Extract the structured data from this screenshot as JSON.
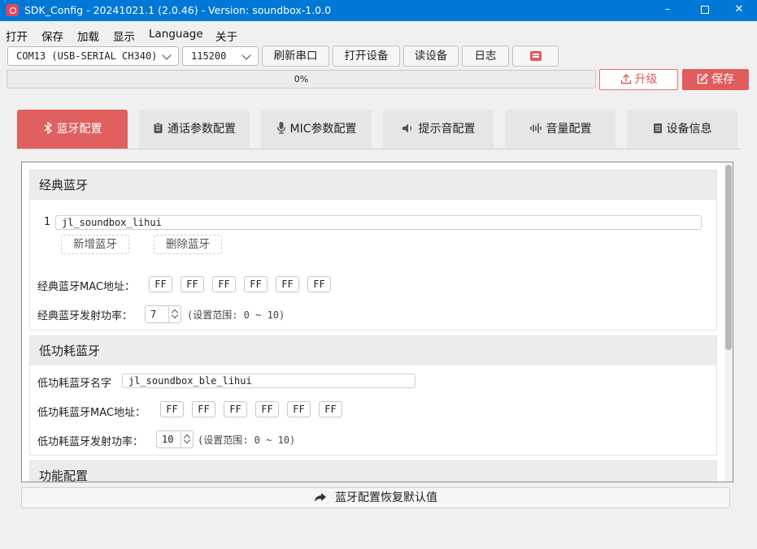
{
  "window": {
    "title": "SDK_Config -  20241021.1  (2.0.46) - Version: soundbox-1.0.0",
    "minimize": "–",
    "close": "✕"
  },
  "menu": [
    "打开",
    "保存",
    "加载",
    "显示",
    "Language",
    "关于"
  ],
  "toolbar": {
    "port": "COM13 (USB-SERIAL CH340)",
    "baud": "115200",
    "refresh_port": "刷新串口",
    "open_device": "打开设备",
    "read_device": "读设备",
    "log": "日志"
  },
  "progress": {
    "text": "0%",
    "value": 0
  },
  "actions": {
    "upgrade": "升级",
    "save": "保存"
  },
  "tabs": [
    {
      "label": "蓝牙配置",
      "icon": "bluetooth-icon",
      "active": true
    },
    {
      "label": "通话参数配置",
      "icon": "clipboard-icon",
      "active": false
    },
    {
      "label": "MIC参数配置",
      "icon": "microphone-icon",
      "active": false
    },
    {
      "label": "提示音配置",
      "icon": "speaker-icon",
      "active": false
    },
    {
      "label": "音量配置",
      "icon": "sound-wave-icon",
      "active": false
    },
    {
      "label": "设备信息",
      "icon": "document-icon",
      "active": false
    }
  ],
  "classic_bt": {
    "title": "经典蓝牙",
    "names": [
      {
        "index": "1",
        "value": "jl_soundbox_lihui"
      }
    ],
    "add_button": "新增蓝牙",
    "delete_button": "删除蓝牙",
    "mac_label": "经典蓝牙MAC地址：",
    "mac": [
      "FF",
      "FF",
      "FF",
      "FF",
      "FF",
      "FF"
    ],
    "power_label": "经典蓝牙发射功率：",
    "power_value": "7",
    "power_range": "(设置范围: 0 ~ 10)"
  },
  "ble": {
    "title": "低功耗蓝牙",
    "name_label": "低功耗蓝牙名字",
    "name_value": "jl_soundbox_ble_lihui",
    "mac_label": "低功耗蓝牙MAC地址：",
    "mac": [
      "FF",
      "FF",
      "FF",
      "FF",
      "FF",
      "FF"
    ],
    "power_label": "低功耗蓝牙发射功率：",
    "power_value": "10",
    "power_range": "(设置范围: 0 ~ 10)"
  },
  "function_config": {
    "title": "功能配置"
  },
  "restore_button": "蓝牙配置恢复默认值",
  "colors": {
    "accent": "#e06060",
    "titlebar": "#0078d7"
  }
}
